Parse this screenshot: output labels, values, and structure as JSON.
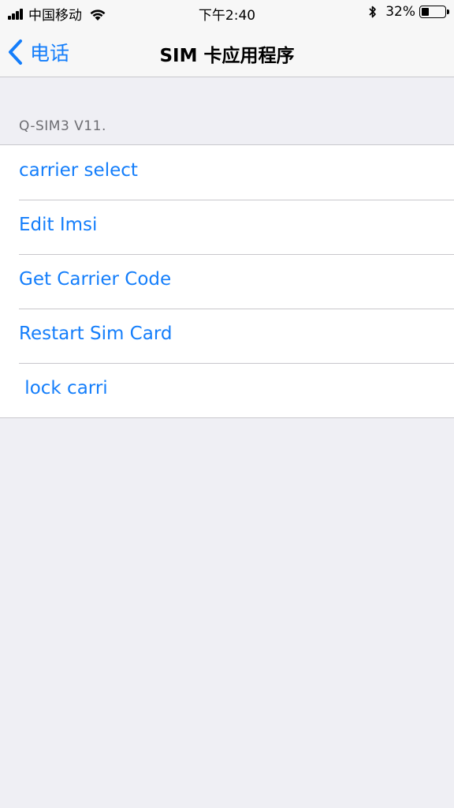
{
  "status_bar": {
    "carrier": "中国移动",
    "time": "下午2:40",
    "battery_percent": "32%",
    "battery_level": 0.32,
    "icons": [
      "signal-icon",
      "wifi-icon",
      "bluetooth-icon",
      "battery-icon"
    ]
  },
  "nav": {
    "back_label": "电话",
    "title": "SIM 卡应用程序"
  },
  "section": {
    "header": "Q-SIM3 V11.",
    "items": [
      {
        "label": "carrier select"
      },
      {
        "label": "Edit Imsi"
      },
      {
        "label": "Get Carrier Code"
      },
      {
        "label": "Restart Sim Card"
      },
      {
        "label": " lock carri"
      }
    ]
  },
  "colors": {
    "accent": "#147efb",
    "background": "#efeff4",
    "separator": "#c8c7cc",
    "section_text": "#6d6d72"
  }
}
